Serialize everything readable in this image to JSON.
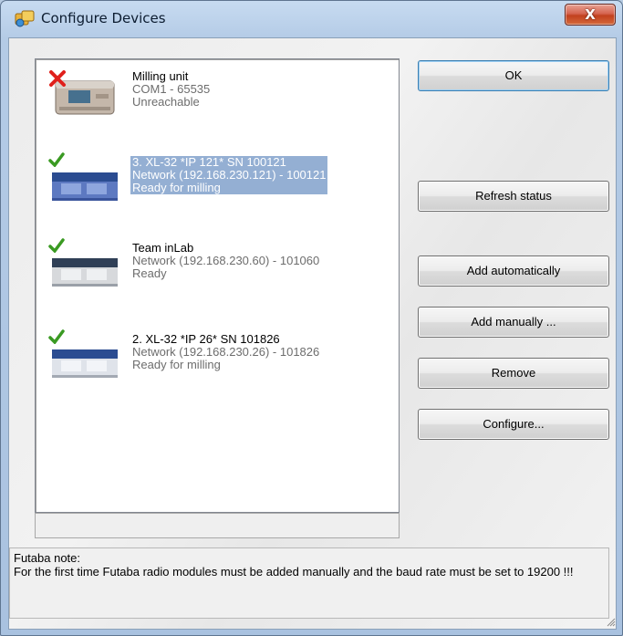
{
  "window": {
    "title": "Configure Devices",
    "close_label": "X"
  },
  "devices": [
    {
      "name": "Milling unit",
      "connection": "COM1 - 65535",
      "status": "Unreachable",
      "state_icon": "error-x-icon",
      "selected": false
    },
    {
      "name": "3. XL-32 *IP 121* SN 100121",
      "connection": "Network (192.168.230.121) - 100121",
      "status": "Ready for milling",
      "state_icon": "checkmark-icon",
      "selected": true
    },
    {
      "name": "Team inLab",
      "connection": "Network (192.168.230.60) - 101060",
      "status": "Ready",
      "state_icon": "checkmark-icon",
      "selected": false
    },
    {
      "name": "2. XL-32 *IP 26* SN 101826",
      "connection": "Network (192.168.230.26) - 101826",
      "status": "Ready for milling",
      "state_icon": "checkmark-icon",
      "selected": false
    }
  ],
  "buttons": {
    "ok": "OK",
    "refresh": "Refresh status",
    "add_auto": "Add automatically",
    "add_manual": "Add manually ...",
    "remove": "Remove",
    "configure": "Configure..."
  },
  "note": {
    "line1": "Futaba note:",
    "line2": "For the first time Futaba radio modules must be added manually and the baud rate must be set to 19200 !!!"
  },
  "colors": {
    "selection": "#94afd3",
    "error": "#e0201b",
    "ok_check": "#3a9a22"
  }
}
